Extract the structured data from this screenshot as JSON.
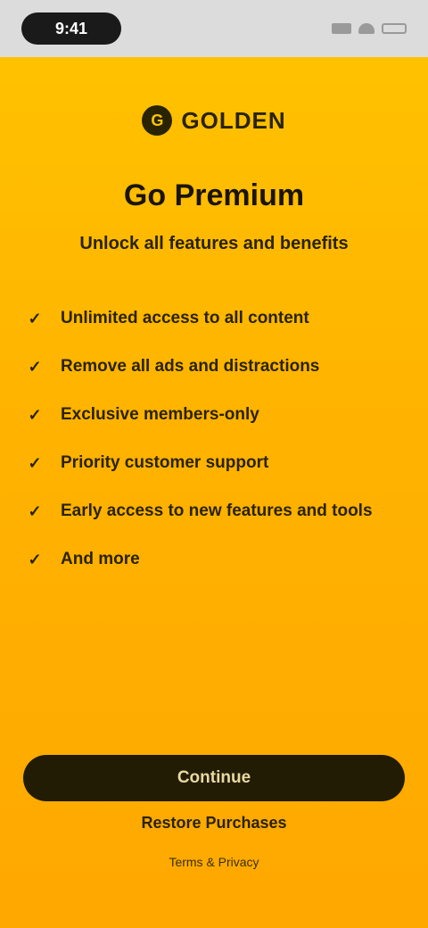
{
  "status_bar": {
    "time": "9:41",
    "icons": [
      "signal-icon",
      "wifi-icon",
      "battery-icon"
    ]
  },
  "logo": {
    "icon": "brand-logo-icon",
    "mark": "G",
    "text": "GOLDEN"
  },
  "header": {
    "title": "Go Premium",
    "subtitle": "Unlock all features and benefits"
  },
  "features": [
    {
      "icon": "check-icon",
      "label": "Unlimited access to all content"
    },
    {
      "icon": "check-icon",
      "label": "Remove all ads and distractions"
    },
    {
      "icon": "check-icon",
      "label": "Exclusive members-only"
    },
    {
      "icon": "check-icon",
      "label": "Priority customer support"
    },
    {
      "icon": "check-icon",
      "label": "Early access to new features and tools"
    },
    {
      "icon": "check-icon",
      "label": "And more"
    }
  ],
  "actions": {
    "continue_label": "Continue",
    "restore_label": "Restore Purchases",
    "terms_label": "Terms & Privacy"
  },
  "colors": {
    "background": "#FFB300",
    "button": "#231C05",
    "status_bar": "#DCDCDC"
  }
}
